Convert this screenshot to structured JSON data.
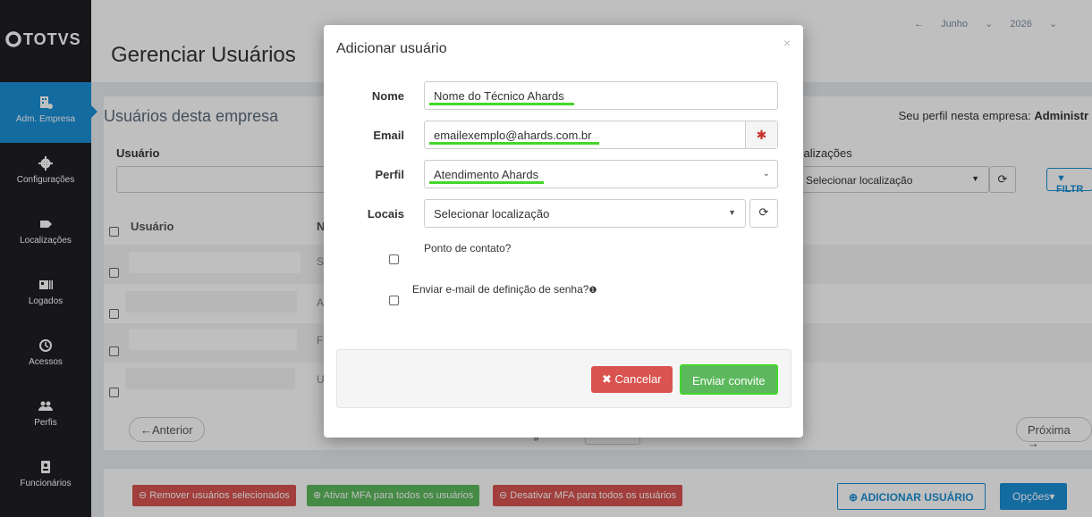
{
  "sidebar": {
    "logo": "TOTVS",
    "items": [
      {
        "label": "Adm. Empresa",
        "icon": "building-icon"
      },
      {
        "label": "Configurações",
        "icon": "gear-icon"
      },
      {
        "label": "Localizações",
        "icon": "tag-icon"
      },
      {
        "label": "Logados",
        "icon": "id-card-icon"
      },
      {
        "label": "Acessos",
        "icon": "history-icon"
      },
      {
        "label": "Perfis",
        "icon": "users-icon"
      },
      {
        "label": "Funcionários",
        "icon": "badge-icon"
      }
    ]
  },
  "header": {
    "title": "Gerenciar Usuários",
    "month": "Junho",
    "year": "2026"
  },
  "panel": {
    "subtitle": "Usuários desta empresa",
    "profile_prefix": "Seu perfil nesta empresa: ",
    "profile_value": "Administr",
    "filter_user_label": "Usuário",
    "filter_locations_label": "calizações",
    "filter_locations_select": "Selecionar localização",
    "filter_button": "FILTR",
    "col_user": "Usuário",
    "col_name": "N",
    "rows": [
      {
        "name_initial": "S"
      },
      {
        "name_initial": "A"
      },
      {
        "name_initial": "F"
      },
      {
        "name_initial": "U"
      }
    ],
    "prev": "←Anterior",
    "next": "Próxima →",
    "page_label": "g"
  },
  "footer": {
    "remove": "Remover usuários selecionados",
    "enable_mfa": "Ativar MFA para todos os usuários",
    "disable_mfa": "Desativar MFA para todos os usuários",
    "add_user": "ADICIONAR USUÁRIO",
    "options": "Opções"
  },
  "modal": {
    "title": "Adicionar usuário",
    "close": "×",
    "name_label": "Nome",
    "name_value": "Nome do Técnico Ahards",
    "email_label": "Email",
    "email_value": "emailexemplo@ahards.com.br",
    "profile_label": "Perfil",
    "profile_value": "Atendimento Ahards",
    "locations_label": "Locais",
    "locations_value": "Selecionar localização",
    "contact_point": "Ponto de contato?",
    "send_password_email": "Enviar e-mail de definição de senha?",
    "cancel": "Cancelar",
    "send_invite": "Enviar convite"
  },
  "colors": {
    "accent": "#1a8fd6",
    "highlight": "#44d62c",
    "danger": "#d9534f",
    "success": "#5cb85c"
  }
}
